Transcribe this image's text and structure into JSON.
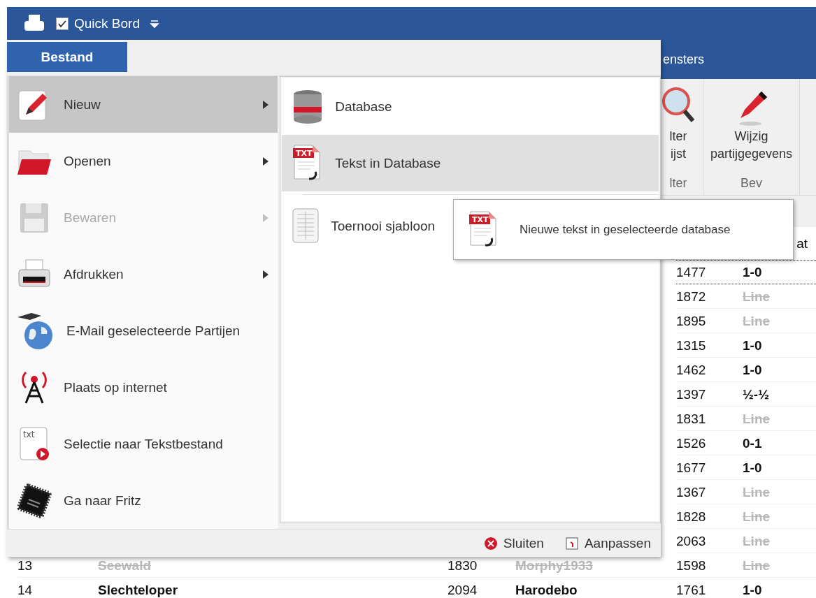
{
  "quick_access": {
    "checkbox": {
      "label": "Quick Bord",
      "checked": true
    }
  },
  "ribbon": {
    "tabs": [
      {
        "label": "ensters"
      }
    ],
    "groups": [
      {
        "label": "lter",
        "buttons": [
          {
            "lines": [
              "lter",
              "ijst"
            ]
          }
        ]
      },
      {
        "label": "Bev",
        "buttons": [
          {
            "lines": [
              "Wijzig",
              "partijgegevens"
            ]
          }
        ]
      }
    ]
  },
  "table": {
    "columns": [
      "at"
    ],
    "rows": [
      {
        "elo_black": "1477",
        "result": "1-0",
        "struck": false,
        "selected": true
      },
      {
        "elo_black": "1872",
        "result": "Line",
        "struck": true,
        "selected": false
      },
      {
        "elo_black": "1895",
        "result": "Line",
        "struck": true,
        "selected": false
      },
      {
        "elo_black": "1315",
        "result": "1-0",
        "struck": false,
        "selected": false
      },
      {
        "elo_black": "1462",
        "result": "1-0",
        "struck": false,
        "selected": false
      },
      {
        "elo_black": "1397",
        "result": "½-½",
        "struck": false,
        "selected": false
      },
      {
        "elo_black": "1831",
        "result": "Line",
        "struck": true,
        "selected": false
      },
      {
        "elo_black": "1526",
        "result": "0-1",
        "struck": false,
        "selected": false
      },
      {
        "elo_black": "1677",
        "result": "1-0",
        "struck": false,
        "selected": false
      },
      {
        "elo_black": "1367",
        "result": "Line",
        "struck": true,
        "selected": false
      },
      {
        "elo_black": "1828",
        "result": "Line",
        "struck": true,
        "selected": false
      },
      {
        "elo_black": "2063",
        "result": "Line",
        "struck": true,
        "selected": false
      },
      {
        "number": "13",
        "white": "Seewald",
        "elo_white": "1830",
        "black": "Morphy1933",
        "elo_black": "1598",
        "result": "Line",
        "struck": true,
        "selected": false
      },
      {
        "number": "14",
        "white": "Slechteloper",
        "elo_white": "2094",
        "black": "Harodebo",
        "elo_black": "1761",
        "result": "1-0",
        "struck": false,
        "selected": false
      }
    ]
  },
  "file_menu": {
    "tab": "Bestand",
    "items": [
      {
        "label": "Nieuw",
        "submenu": true,
        "disabled": false,
        "selected": true
      },
      {
        "label": "Openen",
        "submenu": true,
        "disabled": false,
        "selected": false
      },
      {
        "label": "Bewaren",
        "submenu": true,
        "disabled": true,
        "selected": false
      },
      {
        "label": "Afdrukken",
        "submenu": true,
        "disabled": false,
        "selected": false
      },
      {
        "label": "E-Mail geselecteerde Partijen",
        "submenu": false,
        "disabled": false,
        "selected": false
      },
      {
        "label": "Plaats op internet",
        "submenu": false,
        "disabled": false,
        "selected": false
      },
      {
        "label": "Selectie naar Tekstbestand",
        "icon_text": "txt",
        "submenu": false,
        "disabled": false,
        "selected": false
      },
      {
        "label": "Ga naar Fritz",
        "submenu": false,
        "disabled": false,
        "selected": false
      }
    ],
    "submenu": [
      {
        "label": "Database",
        "selected": false
      },
      {
        "label": "Tekst in Database",
        "icon_text": "TXT",
        "selected": true
      },
      {
        "label": "Toernooi sjabloon",
        "selected": false
      }
    ],
    "footer": [
      "Sluiten",
      "Aanpassen"
    ],
    "tooltip": {
      "icon_text": "TXT",
      "text": "Nieuwe tekst in geselecteerde database"
    }
  }
}
